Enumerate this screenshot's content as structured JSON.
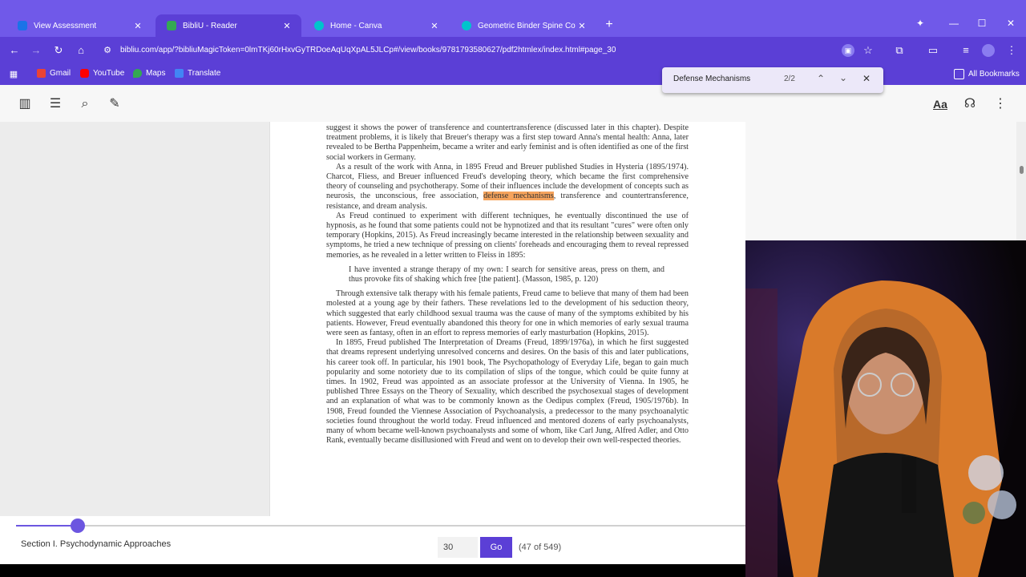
{
  "browser": {
    "tabs": [
      {
        "label": "View Assessment",
        "close": "✕",
        "icon_color": "#1a73e8"
      },
      {
        "label": "BibliU - Reader",
        "close": "✕",
        "icon_color": "#34a853"
      },
      {
        "label": "Home - Canva",
        "close": "✕",
        "icon_color": "#00c4cc"
      },
      {
        "label": "Geometric Binder Spine Cover",
        "close": "✕",
        "icon_color": "#00c4cc"
      }
    ],
    "new_tab": "+",
    "url": "bibliu.com/app/?bibliuMagicToken=0lmTKj60rHxvGyTRDoeAqUqXpAL5JLCp#/view/books/9781793580627/pdf2htmlex/index.html#page_30",
    "bookmarks": [
      "Gmail",
      "YouTube",
      "Maps",
      "Translate"
    ],
    "all_bookmarks": "All Bookmarks",
    "accent": "#5b3fd6",
    "tab_bar_color": "#7059e9"
  },
  "find": {
    "query": "Defense Mechanisms",
    "count": "2/2"
  },
  "reader": {
    "aa_label": "Aa",
    "paragraphs": [
      {
        "pre": "suggest it shows the power of transference and countertransference (discussed later in this chapter). Despite treatment problems, it is likely that Breuer's therapy was a first step toward Anna's mental health: Anna, later revealed to be Bertha Pappenheim, became a writer and early feminist and is often identified as one of the first social workers in Germany."
      },
      {
        "pre": "As a result of the work with Anna, in 1895 Freud and Breuer published Studies in Hysteria (1895/1974). Charcot, Fliess, and Breuer influenced Freud's developing theory, which became the first comprehensive theory of counseling and psychotherapy. Some of their influences include the development of concepts such as neurosis, the unconscious, free association, ",
        "highlight": "defense mechanisms",
        "post": ", transference and countertransference, resistance, and dream analysis."
      },
      {
        "pre": "As Freud continued to experiment with different techniques, he eventually discontinued the use of hypnosis, as he found that some patients could not be hypnotized and that its resultant \"cures\" were often only temporary (Hopkins, 2015). As Freud increasingly became interested in the relationship between sexuality and symptoms, he tried a new technique of pressing on clients' foreheads and encouraging them to reveal repressed memories, as he revealed in a letter written to Fleiss in 1895:"
      },
      {
        "quote": "I have invented a strange therapy of my own: I search for sensitive areas, press on them, and thus provoke fits of shaking which free [the patient]. (Masson, 1985, p. 120)"
      },
      {
        "pre": "Through extensive talk therapy with his female patients, Freud came to believe that many of them had been molested at a young age by their fathers. These revelations led to the development of his seduction theory, which suggested that early childhood sexual trauma was the cause of many of the symptoms exhibited by his patients. However, Freud eventually abandoned this theory for one in which memories of early sexual trauma were seen as fantasy, often in an effort to repress memories of early masturbation (Hopkins, 2015)."
      },
      {
        "pre": "In 1895, Freud published The Interpretation of Dreams (Freud, 1899/1976a), in which he first suggested that dreams represent underlying unresolved concerns and desires. On the basis of this and later publications, his career took off. In particular, his 1901 book, The Psychopathology of Everyday Life, began to gain much popularity and some notoriety due to its compilation of slips of the tongue, which could be quite funny at times. In 1902, Freud was appointed as an associate professor at the University of Vienna. In 1905, he published Three Essays on the Theory of Sexuality, which described the psychosexual stages of development and an explanation of what was to be commonly known as the Oedipus complex (Freud, 1905/1976b). In 1908, Freud founded the Viennese Association of Psychoanalysis, a predecessor to the many psychoanalytic societies found throughout the world today. Freud influenced and mentored dozens of early psychoanalysts, many of whom became well-known psychoanalysts and some of whom, like Carl Jung, Alfred Adler, and Otto Rank, eventually became disillusioned with Freud and went on to develop their own well-respected theories."
      }
    ],
    "section": "Section I. Psychodynamic Approaches",
    "slider_progress": 0.085,
    "page_input": "30",
    "go_label": "Go",
    "page_count": "(47 of 549)"
  }
}
